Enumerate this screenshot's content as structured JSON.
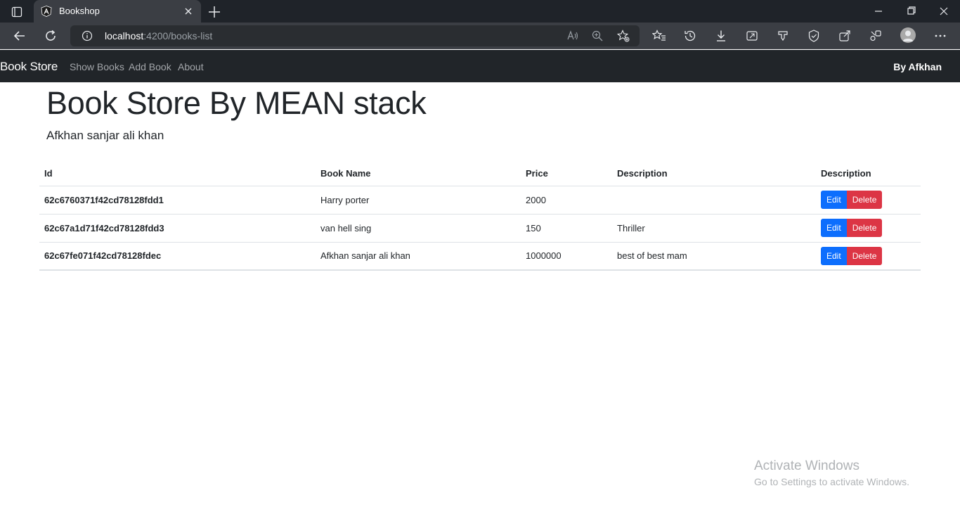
{
  "browser": {
    "tab_title": "Bookshop",
    "url_host": "localhost",
    "url_rest": ":4200/books-list"
  },
  "navbar": {
    "brand": "Book Store",
    "links": [
      "Show Books",
      "Add Book",
      "About"
    ],
    "right_text": "By Afkhan",
    "background": "#212529"
  },
  "page": {
    "title": "Book Store By MEAN stack",
    "subtitle": "Afkhan sanjar ali khan"
  },
  "table": {
    "headers": [
      "Id",
      "Book Name",
      "Price",
      "Description",
      "Description"
    ],
    "rows": [
      {
        "id": "62c6760371f42cd78128fdd1",
        "name": "Harry porter",
        "price": "2000",
        "description": ""
      },
      {
        "id": "62c67a1d71f42cd78128fdd3",
        "name": "van hell sing",
        "price": "150",
        "description": "Thriller"
      },
      {
        "id": "62c67fe071f42cd78128fdec",
        "name": "Afkhan sanjar ali khan",
        "price": "1000000",
        "description": "best of best mam"
      }
    ],
    "edit_label": "Edit",
    "delete_label": "Delete",
    "edit_color": "#0d6efd",
    "delete_color": "#dc3545"
  },
  "watermark": {
    "line1": "Activate Windows",
    "line2": "Go to Settings to activate Windows."
  }
}
